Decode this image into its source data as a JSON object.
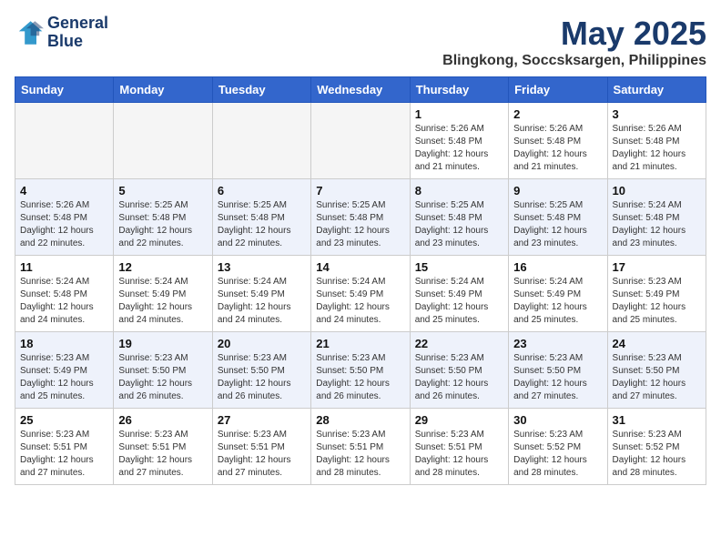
{
  "header": {
    "logo_line1": "General",
    "logo_line2": "Blue",
    "month_title": "May 2025",
    "location": "Blingkong, Soccsksargen, Philippines"
  },
  "weekdays": [
    "Sunday",
    "Monday",
    "Tuesday",
    "Wednesday",
    "Thursday",
    "Friday",
    "Saturday"
  ],
  "weeks": [
    [
      {
        "day": "",
        "info": ""
      },
      {
        "day": "",
        "info": ""
      },
      {
        "day": "",
        "info": ""
      },
      {
        "day": "",
        "info": ""
      },
      {
        "day": "1",
        "info": "Sunrise: 5:26 AM\nSunset: 5:48 PM\nDaylight: 12 hours\nand 21 minutes."
      },
      {
        "day": "2",
        "info": "Sunrise: 5:26 AM\nSunset: 5:48 PM\nDaylight: 12 hours\nand 21 minutes."
      },
      {
        "day": "3",
        "info": "Sunrise: 5:26 AM\nSunset: 5:48 PM\nDaylight: 12 hours\nand 21 minutes."
      }
    ],
    [
      {
        "day": "4",
        "info": "Sunrise: 5:26 AM\nSunset: 5:48 PM\nDaylight: 12 hours\nand 22 minutes."
      },
      {
        "day": "5",
        "info": "Sunrise: 5:25 AM\nSunset: 5:48 PM\nDaylight: 12 hours\nand 22 minutes."
      },
      {
        "day": "6",
        "info": "Sunrise: 5:25 AM\nSunset: 5:48 PM\nDaylight: 12 hours\nand 22 minutes."
      },
      {
        "day": "7",
        "info": "Sunrise: 5:25 AM\nSunset: 5:48 PM\nDaylight: 12 hours\nand 23 minutes."
      },
      {
        "day": "8",
        "info": "Sunrise: 5:25 AM\nSunset: 5:48 PM\nDaylight: 12 hours\nand 23 minutes."
      },
      {
        "day": "9",
        "info": "Sunrise: 5:25 AM\nSunset: 5:48 PM\nDaylight: 12 hours\nand 23 minutes."
      },
      {
        "day": "10",
        "info": "Sunrise: 5:24 AM\nSunset: 5:48 PM\nDaylight: 12 hours\nand 23 minutes."
      }
    ],
    [
      {
        "day": "11",
        "info": "Sunrise: 5:24 AM\nSunset: 5:48 PM\nDaylight: 12 hours\nand 24 minutes."
      },
      {
        "day": "12",
        "info": "Sunrise: 5:24 AM\nSunset: 5:49 PM\nDaylight: 12 hours\nand 24 minutes."
      },
      {
        "day": "13",
        "info": "Sunrise: 5:24 AM\nSunset: 5:49 PM\nDaylight: 12 hours\nand 24 minutes."
      },
      {
        "day": "14",
        "info": "Sunrise: 5:24 AM\nSunset: 5:49 PM\nDaylight: 12 hours\nand 24 minutes."
      },
      {
        "day": "15",
        "info": "Sunrise: 5:24 AM\nSunset: 5:49 PM\nDaylight: 12 hours\nand 25 minutes."
      },
      {
        "day": "16",
        "info": "Sunrise: 5:24 AM\nSunset: 5:49 PM\nDaylight: 12 hours\nand 25 minutes."
      },
      {
        "day": "17",
        "info": "Sunrise: 5:23 AM\nSunset: 5:49 PM\nDaylight: 12 hours\nand 25 minutes."
      }
    ],
    [
      {
        "day": "18",
        "info": "Sunrise: 5:23 AM\nSunset: 5:49 PM\nDaylight: 12 hours\nand 25 minutes."
      },
      {
        "day": "19",
        "info": "Sunrise: 5:23 AM\nSunset: 5:50 PM\nDaylight: 12 hours\nand 26 minutes."
      },
      {
        "day": "20",
        "info": "Sunrise: 5:23 AM\nSunset: 5:50 PM\nDaylight: 12 hours\nand 26 minutes."
      },
      {
        "day": "21",
        "info": "Sunrise: 5:23 AM\nSunset: 5:50 PM\nDaylight: 12 hours\nand 26 minutes."
      },
      {
        "day": "22",
        "info": "Sunrise: 5:23 AM\nSunset: 5:50 PM\nDaylight: 12 hours\nand 26 minutes."
      },
      {
        "day": "23",
        "info": "Sunrise: 5:23 AM\nSunset: 5:50 PM\nDaylight: 12 hours\nand 27 minutes."
      },
      {
        "day": "24",
        "info": "Sunrise: 5:23 AM\nSunset: 5:50 PM\nDaylight: 12 hours\nand 27 minutes."
      }
    ],
    [
      {
        "day": "25",
        "info": "Sunrise: 5:23 AM\nSunset: 5:51 PM\nDaylight: 12 hours\nand 27 minutes."
      },
      {
        "day": "26",
        "info": "Sunrise: 5:23 AM\nSunset: 5:51 PM\nDaylight: 12 hours\nand 27 minutes."
      },
      {
        "day": "27",
        "info": "Sunrise: 5:23 AM\nSunset: 5:51 PM\nDaylight: 12 hours\nand 27 minutes."
      },
      {
        "day": "28",
        "info": "Sunrise: 5:23 AM\nSunset: 5:51 PM\nDaylight: 12 hours\nand 28 minutes."
      },
      {
        "day": "29",
        "info": "Sunrise: 5:23 AM\nSunset: 5:51 PM\nDaylight: 12 hours\nand 28 minutes."
      },
      {
        "day": "30",
        "info": "Sunrise: 5:23 AM\nSunset: 5:52 PM\nDaylight: 12 hours\nand 28 minutes."
      },
      {
        "day": "31",
        "info": "Sunrise: 5:23 AM\nSunset: 5:52 PM\nDaylight: 12 hours\nand 28 minutes."
      }
    ]
  ]
}
